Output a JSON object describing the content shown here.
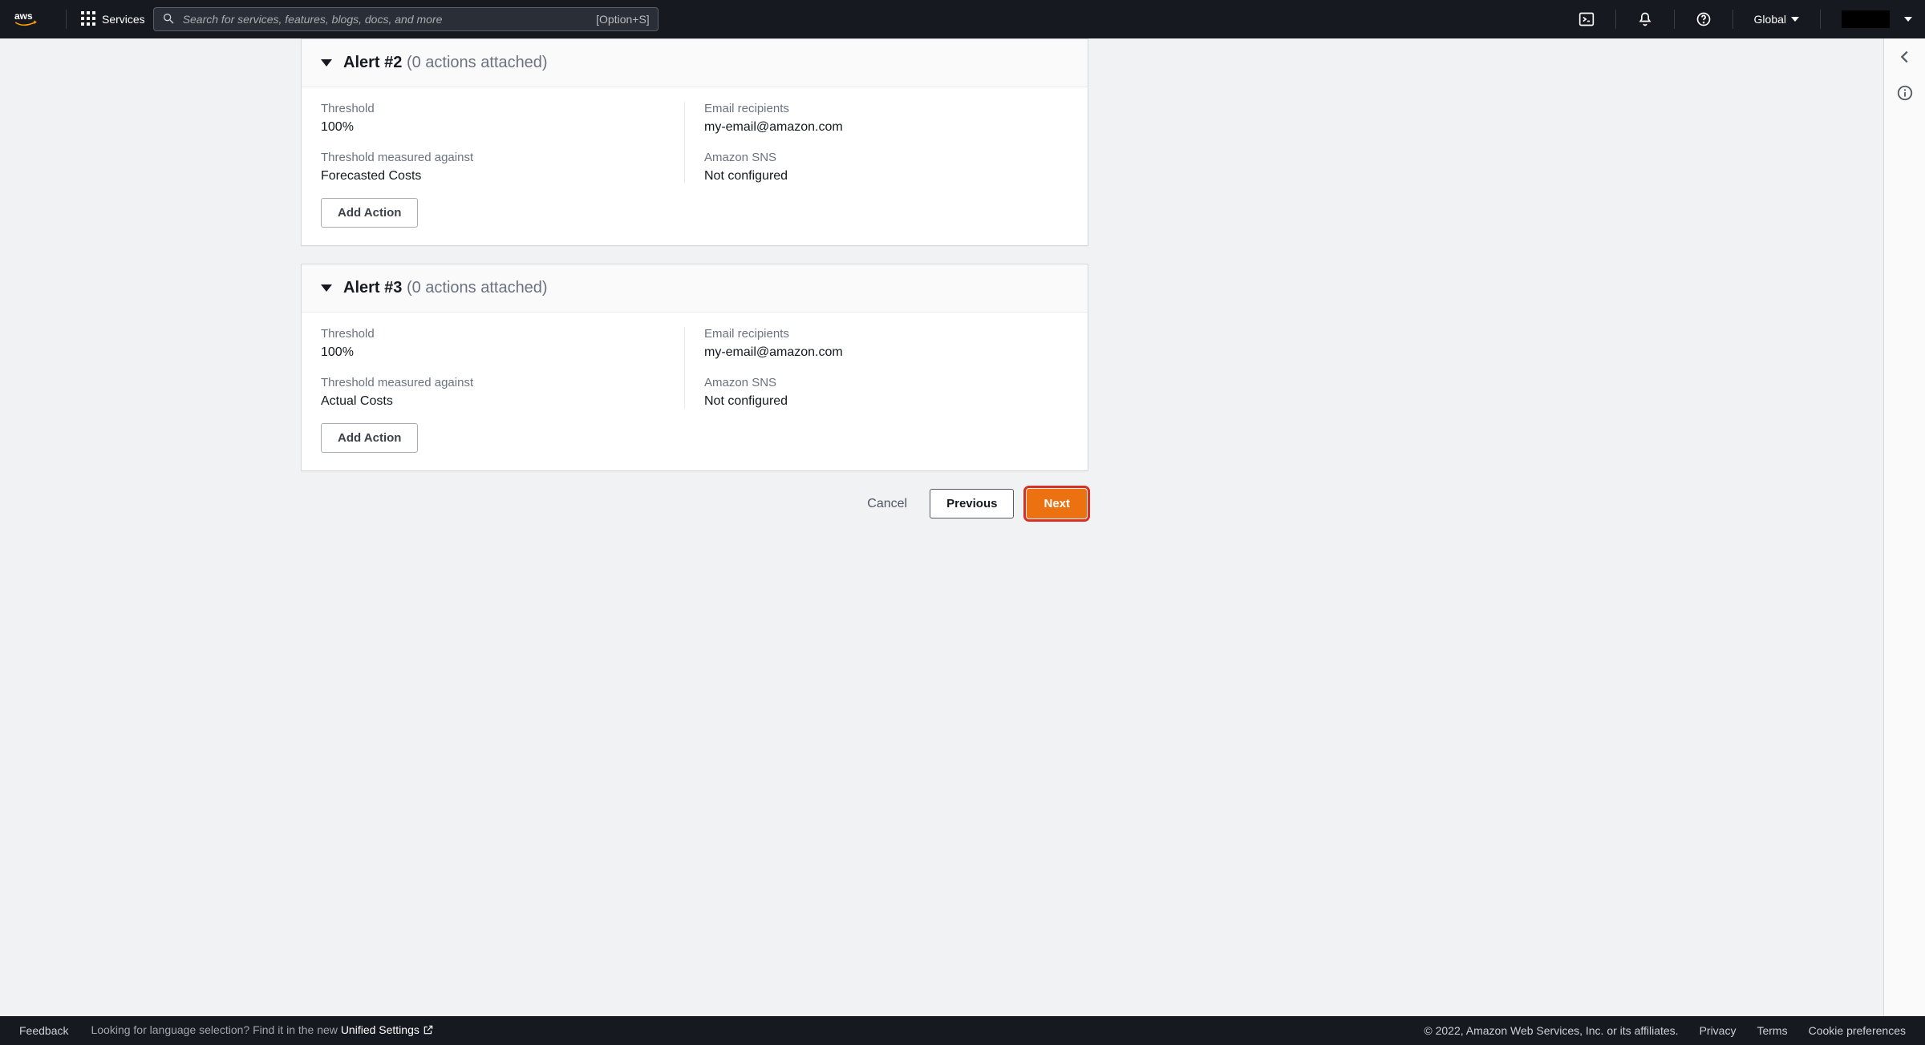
{
  "topnav": {
    "services_label": "Services",
    "search_placeholder": "Search for services, features, blogs, docs, and more",
    "search_shortcut": "[Option+S]",
    "region": "Global"
  },
  "alerts": [
    {
      "title": "Alert #2",
      "actions_summary": "(0 actions attached)",
      "threshold_label": "Threshold",
      "threshold_value": "100%",
      "measured_label": "Threshold measured against",
      "measured_value": "Forecasted Costs",
      "email_label": "Email recipients",
      "email_value": "my-email@amazon.com",
      "sns_label": "Amazon SNS",
      "sns_value": "Not configured",
      "add_action_label": "Add Action"
    },
    {
      "title": "Alert #3",
      "actions_summary": "(0 actions attached)",
      "threshold_label": "Threshold",
      "threshold_value": "100%",
      "measured_label": "Threshold measured against",
      "measured_value": "Actual Costs",
      "email_label": "Email recipients",
      "email_value": "my-email@amazon.com",
      "sns_label": "Amazon SNS",
      "sns_value": "Not configured",
      "add_action_label": "Add Action"
    }
  ],
  "wizard": {
    "cancel": "Cancel",
    "previous": "Previous",
    "next": "Next"
  },
  "footer": {
    "feedback": "Feedback",
    "lang_prompt_pre": "Looking for language selection? Find it in the new ",
    "lang_prompt_link": "Unified Settings",
    "copyright": "© 2022, Amazon Web Services, Inc. or its affiliates.",
    "privacy": "Privacy",
    "terms": "Terms",
    "cookies": "Cookie preferences"
  }
}
